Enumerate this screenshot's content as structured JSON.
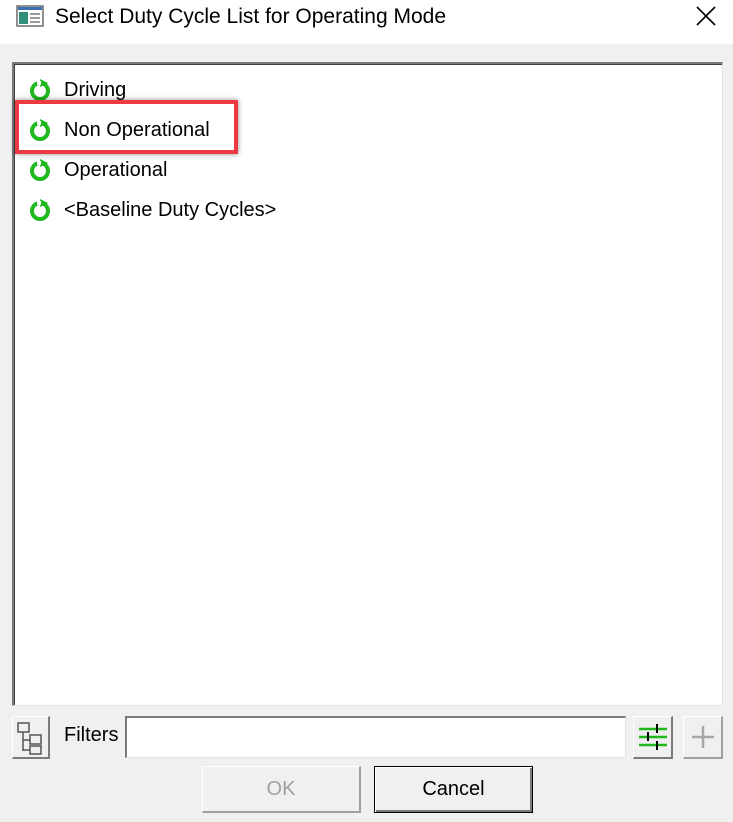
{
  "window": {
    "title": "Select Duty Cycle List for Operating Mode",
    "app_icon": "window-app-icon",
    "close_icon": "close-icon"
  },
  "list": {
    "items": [
      {
        "label": "Driving",
        "icon": "green-refresh-icon"
      },
      {
        "label": "Non Operational",
        "icon": "green-refresh-icon",
        "highlighted": true
      },
      {
        "label": "Operational",
        "icon": "green-refresh-icon"
      },
      {
        "label": "<Baseline Duty Cycles>",
        "icon": "green-refresh-icon"
      }
    ],
    "highlight_color": "#ec3a45",
    "icon_color": "#1fb81f"
  },
  "filters": {
    "label": "Filters",
    "value": "",
    "placeholder": ""
  },
  "buttons": {
    "ok_label": "OK",
    "ok_enabled": false,
    "cancel_label": "Cancel"
  }
}
